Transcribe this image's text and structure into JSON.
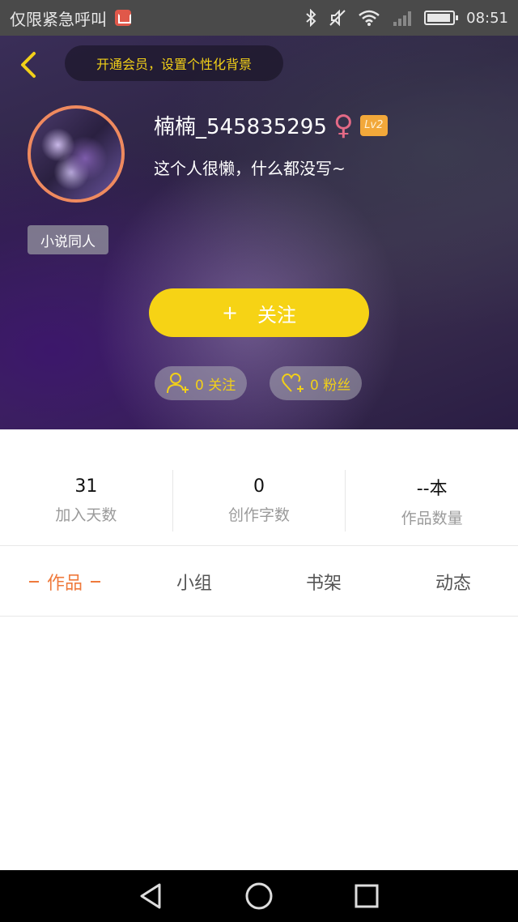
{
  "status_bar": {
    "carrier_text": "仅限紧急呼叫",
    "time": "08:51"
  },
  "header": {
    "vip_tip": "开通会员，设置个性化背景",
    "username": "楠楠_545835295",
    "gender_symbol": "♀",
    "level": "Lv2",
    "bio": "这个人很懒，什么都没写~",
    "tag": "小说同人",
    "follow_plus": "+",
    "follow_label": "关注",
    "following_text": "0 关注",
    "fans_text": "0 粉丝"
  },
  "stats": [
    {
      "value": "31",
      "label": "加入天数"
    },
    {
      "value": "0",
      "label": "创作字数"
    },
    {
      "value": "--本",
      "label": "作品数量"
    }
  ],
  "tabs": [
    {
      "label": "作品",
      "active": true
    },
    {
      "label": "小组",
      "active": false
    },
    {
      "label": "书架",
      "active": false
    },
    {
      "label": "动态",
      "active": false
    }
  ],
  "colors": {
    "accent": "#f6d315",
    "tab_active": "#ef7a3c",
    "avatar_border": "#ef8a5f",
    "level_badge": "#f2a83a"
  }
}
